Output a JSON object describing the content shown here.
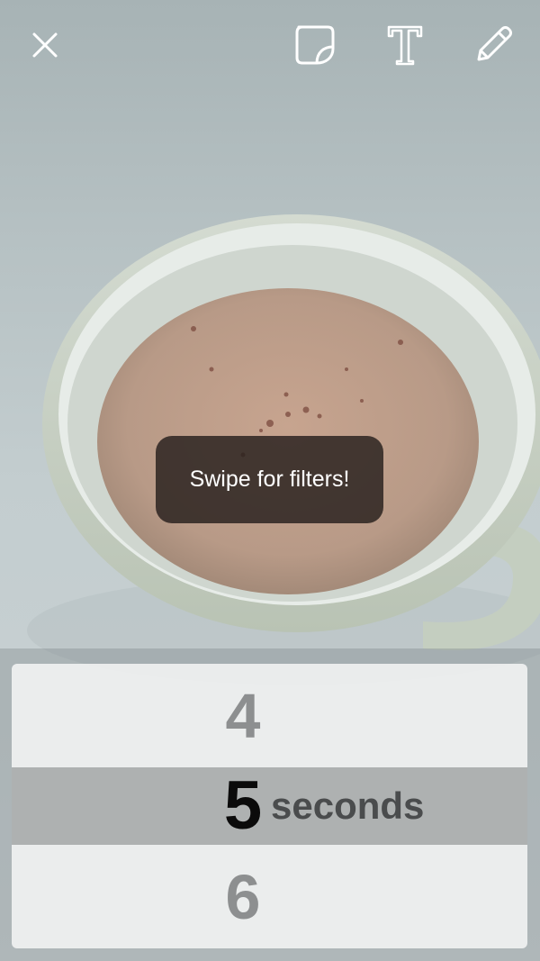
{
  "toolbar": {
    "close_icon": "close-icon",
    "sticker_icon": "sticker-icon",
    "text_icon": "text-icon",
    "text_glyph": "T",
    "pencil_icon": "pencil-icon"
  },
  "toast": {
    "message": "Swipe for filters!"
  },
  "timer_picker": {
    "options": [
      "4",
      "5",
      "6"
    ],
    "selected": "5",
    "unit_label": "seconds"
  },
  "colors": {
    "toast_background": "#261e1c",
    "selected_row": "#a0a3a4",
    "picker_background": "#f2f3f3",
    "icon_stroke": "#ffffff"
  }
}
